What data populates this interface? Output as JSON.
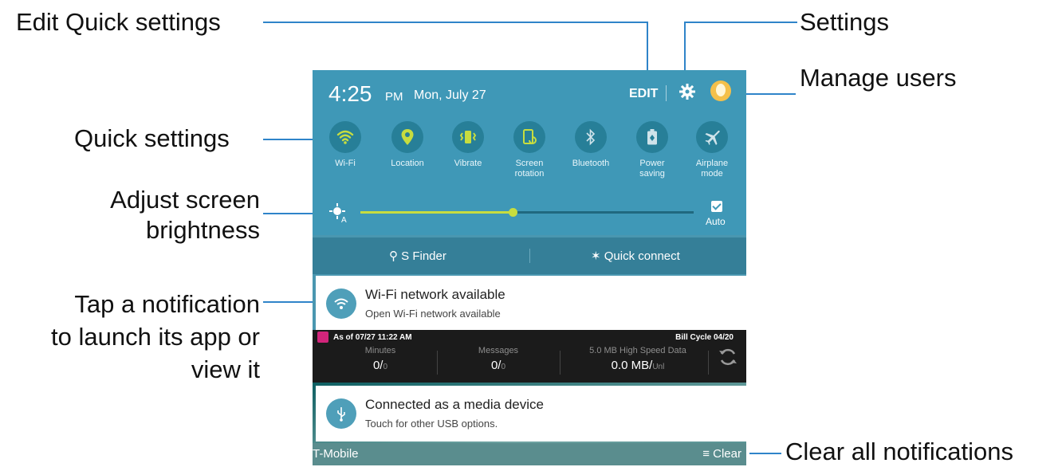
{
  "callouts": {
    "edit_quick_settings": "Edit Quick settings",
    "settings": "Settings",
    "manage_users": "Manage users",
    "quick_settings": "Quick settings",
    "adjust_brightness_1": "Adjust screen",
    "adjust_brightness_2": "brightness",
    "tap_notification_1": "Tap a notification",
    "tap_notification_2": "to launch its app or",
    "tap_notification_3": "view it",
    "clear_all": "Clear all notifications"
  },
  "status": {
    "time": "4:25",
    "ampm": "PM",
    "date": "Mon, July 27",
    "edit_label": "EDIT"
  },
  "quick_settings": [
    {
      "label": "Wi-Fi",
      "icon": "wifi-icon"
    },
    {
      "label": "Location",
      "icon": "location-icon"
    },
    {
      "label": "Vibrate",
      "icon": "vibrate-icon"
    },
    {
      "label": "Screen\nrotation",
      "icon": "screen-rotation-icon"
    },
    {
      "label": "Bluetooth",
      "icon": "bluetooth-icon"
    },
    {
      "label": "Power\nsaving",
      "icon": "power-saving-icon"
    },
    {
      "label": "Airplane\nmode",
      "icon": "airplane-icon"
    }
  ],
  "brightness": {
    "level": 0.46,
    "auto_label": "Auto",
    "auto_checked": true
  },
  "finder": {
    "s_finder": "S Finder",
    "quick_connect": "Quick connect"
  },
  "notifications": [
    {
      "title": "Wi-Fi network available",
      "text": "Open Wi-Fi network available"
    },
    {
      "title": "Connected as a media device",
      "text": "Touch for other USB options."
    }
  ],
  "usage": {
    "as_of_label": "As of",
    "as_of": "07/27 11:22 AM",
    "bill_cycle": "Bill Cycle 04/20",
    "minutes_label": "Minutes",
    "minutes_value": "0/",
    "minutes_limit": "0",
    "messages_label": "Messages",
    "messages_value": "0/",
    "messages_limit": "0",
    "data_label": "5.0 MB High Speed Data",
    "data_value": "0.0 MB/",
    "data_limit": "Unl"
  },
  "footer": {
    "carrier": "T-Mobile",
    "clear": "Clear"
  },
  "colors": {
    "accent": "#3f98b7",
    "line": "#2f84c9",
    "slider": "#c7dd3f"
  }
}
